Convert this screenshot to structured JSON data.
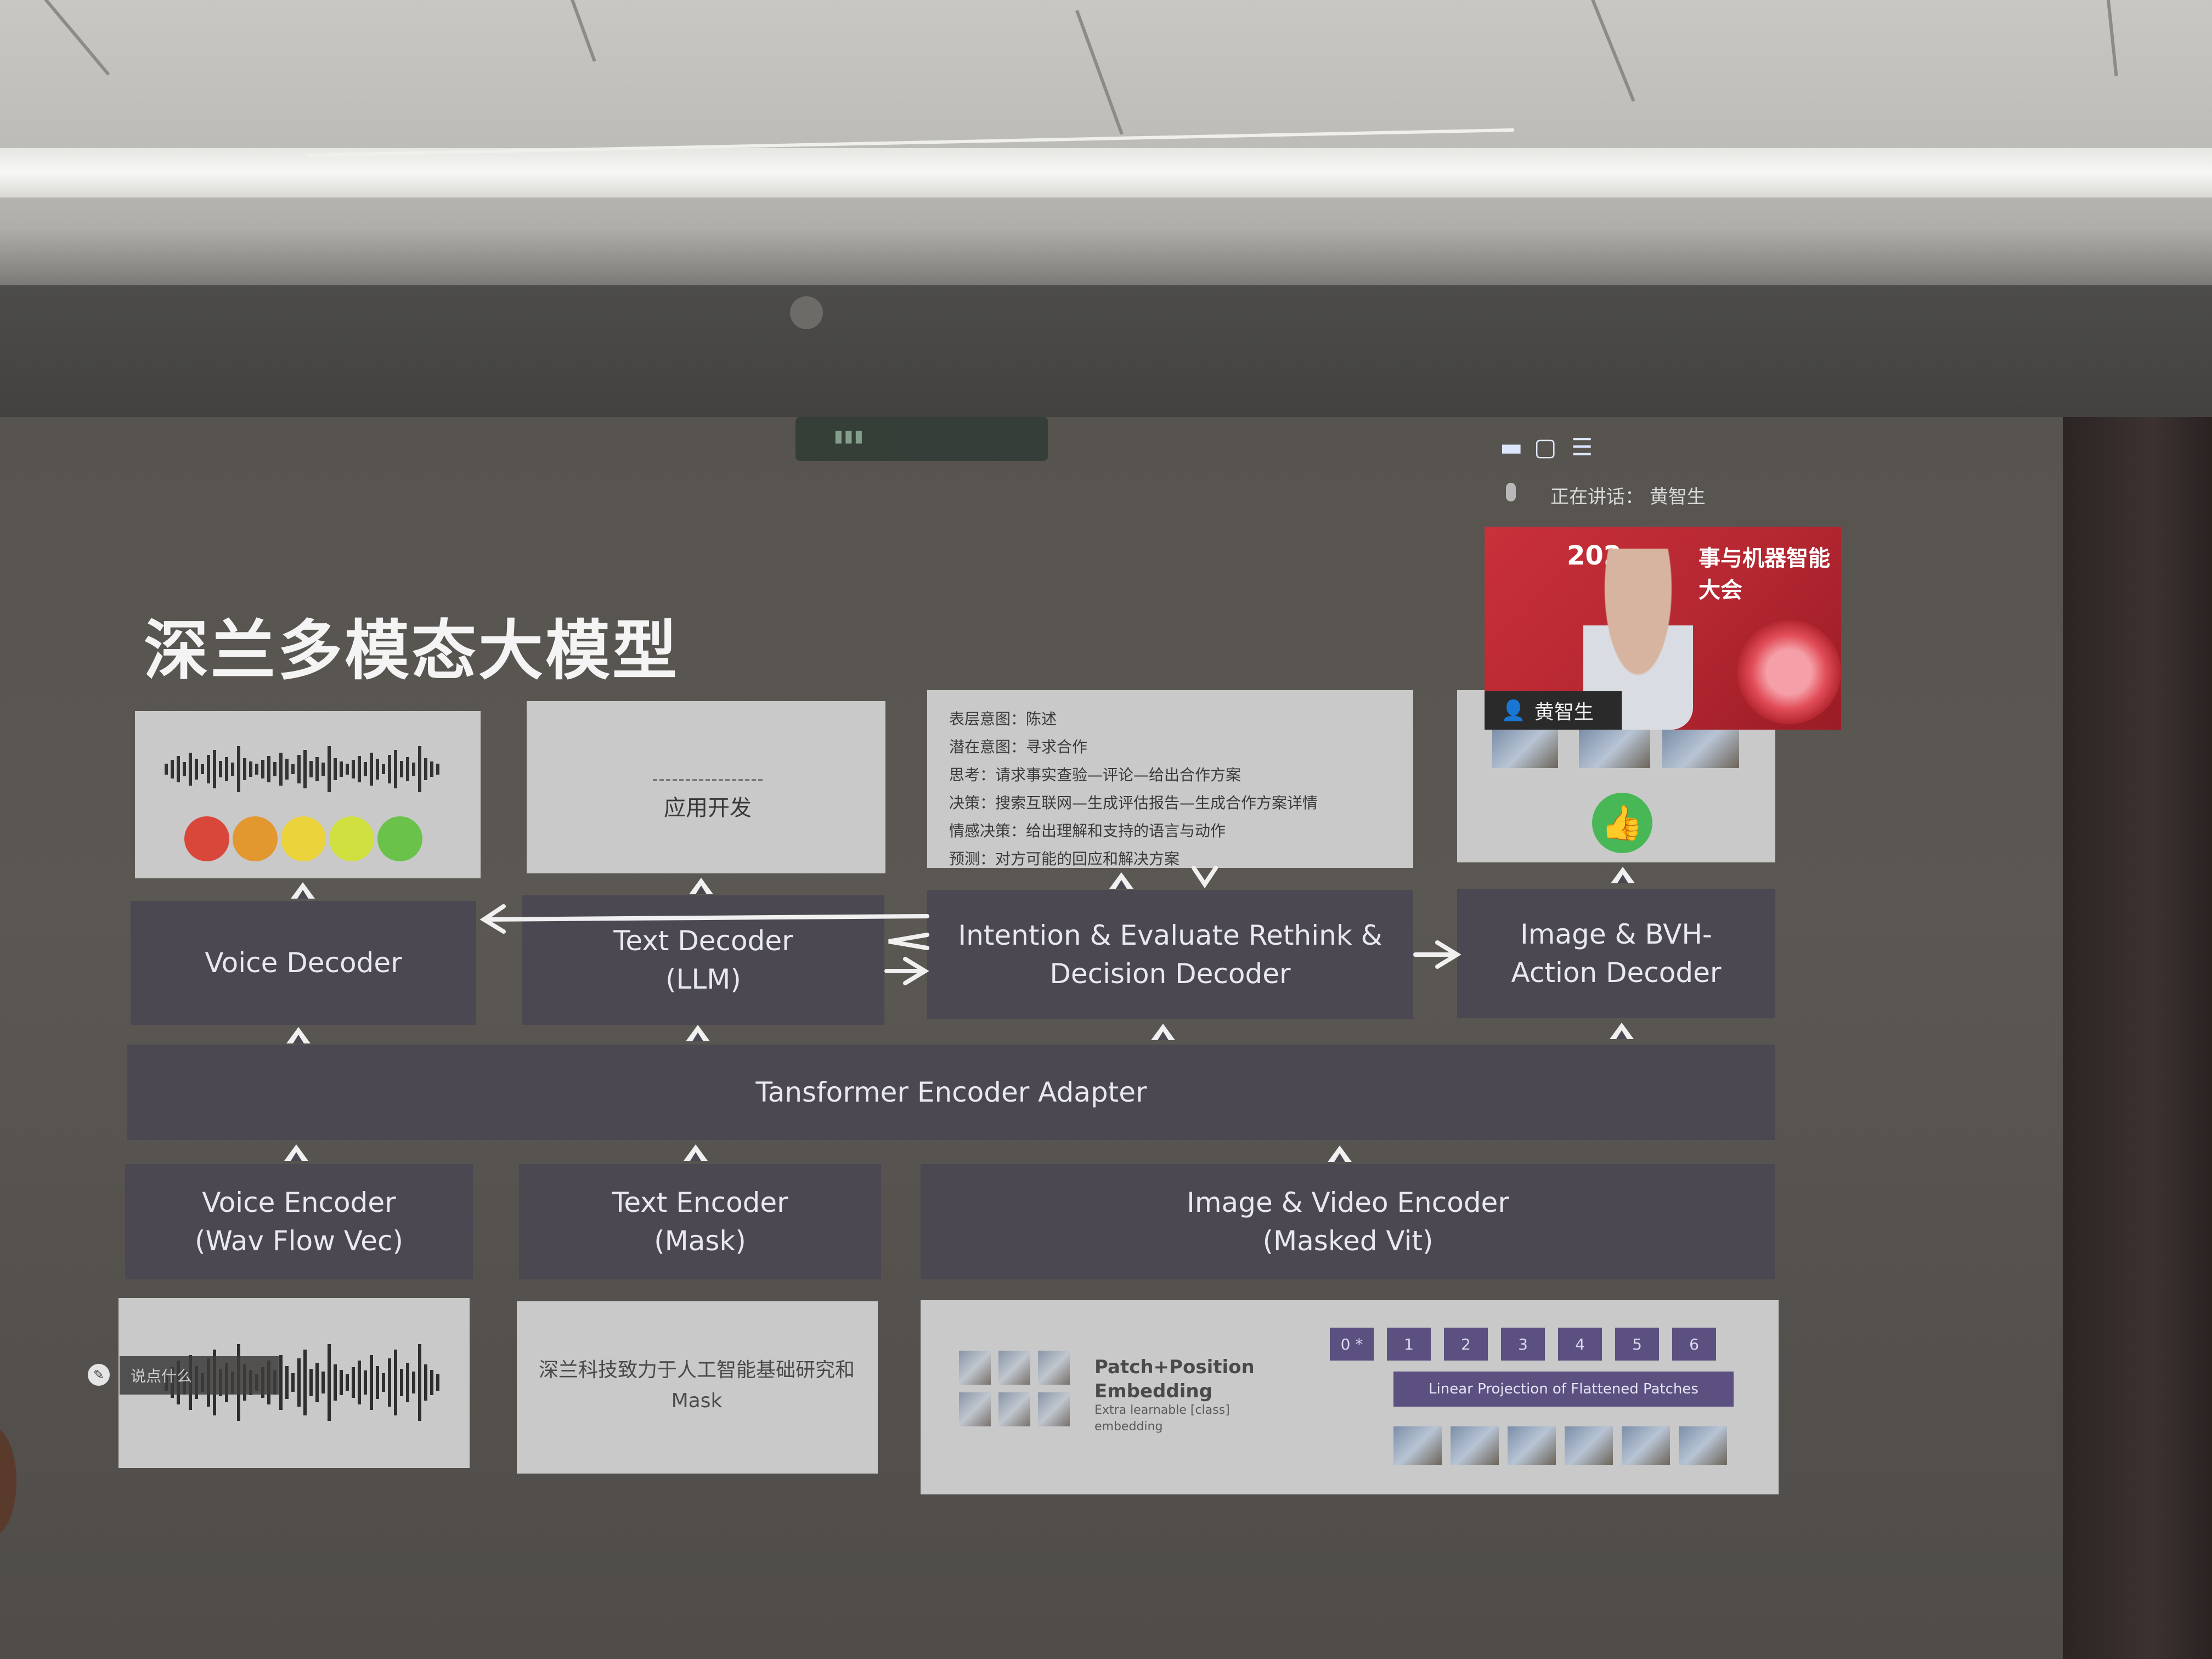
{
  "title": "深兰多模态大模型",
  "decoders": {
    "voice": "Voice Decoder",
    "text": "Text Decoder\n(LLM)",
    "intention": "Intention & Evaluate Rethink &\nDecision Decoder",
    "image_bvh": "Image & BVH-\nAction Decoder"
  },
  "adapter": "Tansformer Encoder Adapter",
  "encoders": {
    "voice": "Voice Encoder\n(Wav Flow Vec)",
    "text": "Text Encoder\n(Mask)",
    "image_video": "Image & Video Encoder\n(Masked Vit)"
  },
  "text_panel": {
    "label": "应用开发"
  },
  "intention_panel": {
    "lines": [
      "表层意图：陈述",
      "潜在意图：寻求合作",
      "思考：请求事实查验—评论—给出合作方案",
      "决策：搜索互联网—生成评估报告—生成合作方案详情",
      "情感决策：给出理解和支持的语言与动作",
      "预测：对方可能的回应和解决方案"
    ]
  },
  "mask_panel": {
    "text": "深兰科技致力于人工智能基础研究和\nMask"
  },
  "patch_panel": {
    "title": "Patch+Position\nEmbedding",
    "subtitle": "Extra learnable [class]\nembedding",
    "linear_label": "Linear Projection of Flattened Patches",
    "tokens": [
      "0 *",
      "1",
      "2",
      "3",
      "4",
      "5",
      "6"
    ]
  },
  "video_call": {
    "speaking_label": "正在讲话：",
    "speaker": "黄智生",
    "name_tag": "黄智生",
    "banner_left": "202",
    "banner_right": "事与机器智能大会"
  },
  "overlay_left": {
    "text": "说点什么"
  },
  "colors": {
    "screen": "#57534f",
    "box": "#4c4852",
    "panel": "#c9c9c9",
    "title": "#f4f4f4",
    "accent_purple": "#5b5080",
    "video_red": "#c9303a",
    "thumbs_green": "#48b856"
  },
  "icons": [
    "mic-icon",
    "thumbs-up-icon",
    "window-minimize-icon",
    "window-restore-icon",
    "menu-icon",
    "user-icon"
  ]
}
